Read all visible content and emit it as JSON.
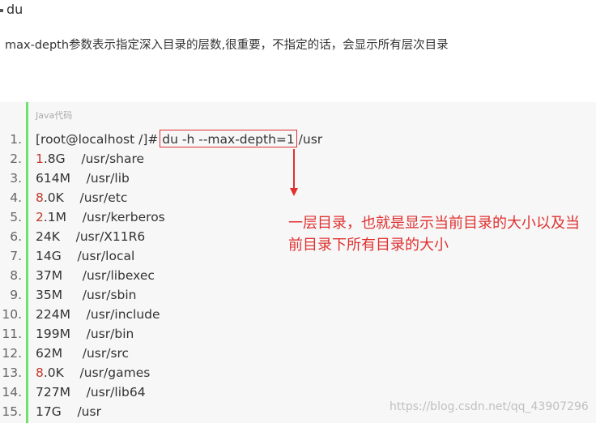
{
  "heading": "du",
  "description": "max-depth参数表示指定深入目录的层数,很重要，不指定的话，会显示所有层次目录",
  "code_block": {
    "language_label": "Java代码",
    "lines": [
      {
        "num": "1.",
        "red": "",
        "text": "[root@localhost /]# du -h --max-depth=1 /usr"
      },
      {
        "num": "2.",
        "red": "1",
        "text": ".8G    /usr/share"
      },
      {
        "num": "3.",
        "red": "",
        "text": "614M    /usr/lib"
      },
      {
        "num": "4.",
        "red": "8",
        "text": ".0K    /usr/etc"
      },
      {
        "num": "5.",
        "red": "2",
        "text": ".1M    /usr/kerberos"
      },
      {
        "num": "6.",
        "red": "",
        "text": "24K    /usr/X11R6"
      },
      {
        "num": "7.",
        "red": "",
        "text": "14G    /usr/local"
      },
      {
        "num": "8.",
        "red": "",
        "text": "37M     /usr/libexec"
      },
      {
        "num": "9.",
        "red": "",
        "text": "35M     /usr/sbin"
      },
      {
        "num": "10.",
        "red": "",
        "text": "224M    /usr/include"
      },
      {
        "num": "11.",
        "red": "",
        "text": "199M    /usr/bin"
      },
      {
        "num": "12.",
        "red": "",
        "text": "62M     /usr/src"
      },
      {
        "num": "13.",
        "red": "8",
        "text": ".0K    /usr/games"
      },
      {
        "num": "14.",
        "red": "",
        "text": "727M    /usr/lib64"
      },
      {
        "num": "15.",
        "red": "",
        "text": "17G    /usr"
      }
    ]
  },
  "annotation": "一层目录，也就是显示当前目录的大小以及当前目录下所有目录的大小",
  "watermark": "https://blog.csdn.net/qq_43907296",
  "colors": {
    "annotation_red": "#e03030",
    "number_red": "#c0392b",
    "gutter_green": "#6ce26c",
    "code_background": "#f7f7f7"
  }
}
